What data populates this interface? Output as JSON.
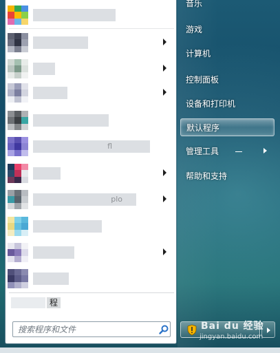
{
  "start_menu": {
    "program_items": [
      {
        "icon": "app-icon",
        "name": "",
        "has_submenu": false
      },
      {
        "icon": "app-icon",
        "name": "",
        "has_submenu": true
      },
      {
        "icon": "app-icon",
        "name": "",
        "has_submenu": true
      },
      {
        "icon": "app-icon",
        "name": "",
        "has_submenu": true
      },
      {
        "icon": "app-icon",
        "name": "",
        "has_submenu": false
      },
      {
        "icon": "app-icon",
        "name": "fl",
        "has_submenu": false
      },
      {
        "icon": "app-icon",
        "name": "",
        "has_submenu": true
      },
      {
        "icon": "app-icon",
        "name": "plo",
        "has_submenu": true
      },
      {
        "icon": "app-icon",
        "name": "",
        "has_submenu": false
      },
      {
        "icon": "app-icon",
        "name": "",
        "has_submenu": true
      },
      {
        "icon": "app-icon",
        "name": "",
        "has_submenu": false
      }
    ],
    "all_programs_label": "程",
    "search": {
      "placeholder": "搜索程序和文件"
    },
    "right_items": [
      {
        "label": "音乐",
        "selected": false
      },
      {
        "label": "游戏",
        "selected": false
      },
      {
        "label": "计算机",
        "selected": false
      },
      {
        "label": "控制面板",
        "selected": false
      },
      {
        "label": "设备和打印机",
        "selected": false
      },
      {
        "label": "默认程序",
        "selected": true
      },
      {
        "label": "管理工具",
        "selected": false,
        "has_submenu": true
      },
      {
        "label": "帮助和支持",
        "selected": false
      }
    ],
    "watermark": {
      "logo": "Bai du 经验",
      "url": "jingyan.baidu.com"
    },
    "colors": {
      "accent_blue": "#2a73c8",
      "glass_top": "#1c5a74",
      "glass_bottom": "#184d5e"
    }
  }
}
